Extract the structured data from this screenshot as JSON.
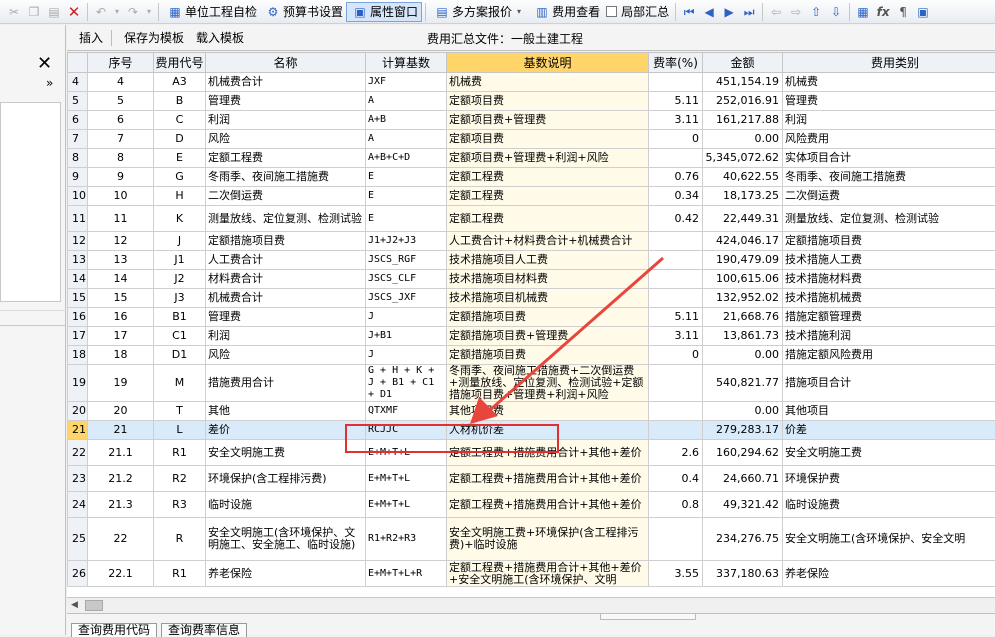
{
  "toolbar": {
    "unit_check": "单位工程自检",
    "budget_settings": "预算书设置",
    "property_window": "属性窗口",
    "multi_plan_quote": "多方案报价",
    "fee_view": "费用查看",
    "local_summary": "局部汇总"
  },
  "left_panel": {
    "close": "✕",
    "expand": "»"
  },
  "subbar": {
    "insert": "插入",
    "save_template": "保存为模板",
    "load_template": "载入模板",
    "file_title": "费用汇总文件：一般土建工程"
  },
  "table": {
    "headers": [
      "",
      "序号",
      "费用代号",
      "名称",
      "计算基数",
      "基数说明",
      "费率(%)",
      "金额",
      "费用类别"
    ],
    "rows": [
      {
        "rn": "4",
        "seq": "4",
        "code": "A3",
        "name": "机械费合计",
        "base": "JXF",
        "desc": "机械费",
        "rate": "",
        "amount": "451,154.19",
        "cat": "机械费"
      },
      {
        "rn": "5",
        "seq": "5",
        "code": "B",
        "name": "管理费",
        "base": "A",
        "desc": "定额项目费",
        "rate": "5.11",
        "amount": "252,016.91",
        "cat": "管理费"
      },
      {
        "rn": "6",
        "seq": "6",
        "code": "C",
        "name": "利润",
        "base": "A+B",
        "desc": "定额项目费+管理费",
        "rate": "3.11",
        "amount": "161,217.88",
        "cat": "利润"
      },
      {
        "rn": "7",
        "seq": "7",
        "code": "D",
        "name": "风险",
        "base": "A",
        "desc": "定额项目费",
        "rate": "0",
        "amount": "0.00",
        "cat": "风险费用"
      },
      {
        "rn": "8",
        "seq": "8",
        "code": "E",
        "name": "定额工程费",
        "base": "A+B+C+D",
        "desc": "定额项目费+管理费+利润+风险",
        "rate": "",
        "amount": "5,345,072.62",
        "cat": "实体项目合计"
      },
      {
        "rn": "9",
        "seq": "9",
        "code": "G",
        "name": "冬雨季、夜间施工措施费",
        "base": "E",
        "desc": "定额工程费",
        "rate": "0.76",
        "amount": "40,622.55",
        "cat": "冬雨季、夜间施工措施费"
      },
      {
        "rn": "10",
        "seq": "10",
        "code": "H",
        "name": "二次倒运费",
        "base": "E",
        "desc": "定额工程费",
        "rate": "0.34",
        "amount": "18,173.25",
        "cat": "二次倒运费"
      },
      {
        "rn": "11",
        "seq": "11",
        "code": "K",
        "name": "测量放线、定位复测、检测试验",
        "base": "E",
        "desc": "定额工程费",
        "rate": "0.42",
        "amount": "22,449.31",
        "cat": "测量放线、定位复测、检测试验"
      },
      {
        "rn": "12",
        "seq": "12",
        "code": "J",
        "name": "定额措施项目费",
        "base": "J1+J2+J3",
        "desc": "人工费合计+材料费合计+机械费合计",
        "rate": "",
        "amount": "424,046.17",
        "cat": "定额措施项目费"
      },
      {
        "rn": "13",
        "seq": "13",
        "code": "J1",
        "name": "人工费合计",
        "base": "JSCS_RGF",
        "desc": "技术措施项目人工费",
        "rate": "",
        "amount": "190,479.09",
        "cat": "技术措施人工费"
      },
      {
        "rn": "14",
        "seq": "14",
        "code": "J2",
        "name": "材料费合计",
        "base": "JSCS_CLF",
        "desc": "技术措施项目材料费",
        "rate": "",
        "amount": "100,615.06",
        "cat": "技术措施材料费"
      },
      {
        "rn": "15",
        "seq": "15",
        "code": "J3",
        "name": "机械费合计",
        "base": "JSCS_JXF",
        "desc": "技术措施项目机械费",
        "rate": "",
        "amount": "132,952.02",
        "cat": "技术措施机械费"
      },
      {
        "rn": "16",
        "seq": "16",
        "code": "B1",
        "name": "管理费",
        "base": "J",
        "desc": "定额措施项目费",
        "rate": "5.11",
        "amount": "21,668.76",
        "cat": "措施定额管理费"
      },
      {
        "rn": "17",
        "seq": "17",
        "code": "C1",
        "name": "利润",
        "base": "J+B1",
        "desc": "定额措施项目费+管理费",
        "rate": "3.11",
        "amount": "13,861.73",
        "cat": "技术措施利润"
      },
      {
        "rn": "18",
        "seq": "18",
        "code": "D1",
        "name": "风险",
        "base": "J",
        "desc": "定额措施项目费",
        "rate": "0",
        "amount": "0.00",
        "cat": "措施定额风险费用"
      },
      {
        "rn": "19",
        "seq": "19",
        "code": "M",
        "name": "措施费用合计",
        "base": "G + H + K + J + B1 + C1 + D1",
        "desc": "冬雨季、夜间施工措施费+二次倒运费+测量放线、定位复测、检测试验+定额措施项目费+管理费+利润+风险",
        "rate": "",
        "amount": "540,821.77",
        "cat": "措施项目合计"
      },
      {
        "rn": "20",
        "seq": "20",
        "code": "T",
        "name": "其他",
        "base": "QTXMF",
        "desc": "其他项目费",
        "rate": "",
        "amount": "0.00",
        "cat": "其他项目"
      },
      {
        "rn": "21",
        "seq": "21",
        "code": "L",
        "name": "差价",
        "base": "RCJJC",
        "desc": "人材机价差",
        "rate": "",
        "amount": "279,283.17",
        "cat": "价差"
      },
      {
        "rn": "22",
        "seq": "21.1",
        "code": "R1",
        "name": "安全文明施工费",
        "base": "E+M+T+L",
        "desc": "定额工程费+措施费用合计+其他+差价",
        "rate": "2.6",
        "amount": "160,294.62",
        "cat": "安全文明施工费"
      },
      {
        "rn": "23",
        "seq": "21.2",
        "code": "R2",
        "name": "环境保护(含工程排污费)",
        "base": "E+M+T+L",
        "desc": "定额工程费+措施费用合计+其他+差价",
        "rate": "0.4",
        "amount": "24,660.71",
        "cat": "环境保护费"
      },
      {
        "rn": "24",
        "seq": "21.3",
        "code": "R3",
        "name": "临时设施",
        "base": "E+M+T+L",
        "desc": "定额工程费+措施费用合计+其他+差价",
        "rate": "0.8",
        "amount": "49,321.42",
        "cat": "临时设施费"
      },
      {
        "rn": "25",
        "seq": "22",
        "code": "R",
        "name": "安全文明施工(含环境保护、文明施工、安全施工、临时设施)",
        "base": "R1+R2+R3",
        "desc": "安全文明施工费+环境保护(含工程排污费)+临时设施",
        "rate": "",
        "amount": "234,276.75",
        "cat": "安全文明施工(含环境保护、安全文明"
      },
      {
        "rn": "26",
        "seq": "22.1",
        "code": "R1",
        "name": "养老保险",
        "base": "E+M+T+L+R",
        "desc": "定额工程费+措施费用合计+其他+差价+安全文明施工(含环境保护、文明",
        "rate": "3.55",
        "amount": "337,180.63",
        "cat": "养老保险"
      }
    ]
  },
  "status": {
    "tab1": "查询费用代码",
    "tab2": "查询费率信息"
  },
  "colors": {
    "highlight": "#ffd56a",
    "annotation": "#e03030",
    "selected_row": "#d9ebfa"
  }
}
